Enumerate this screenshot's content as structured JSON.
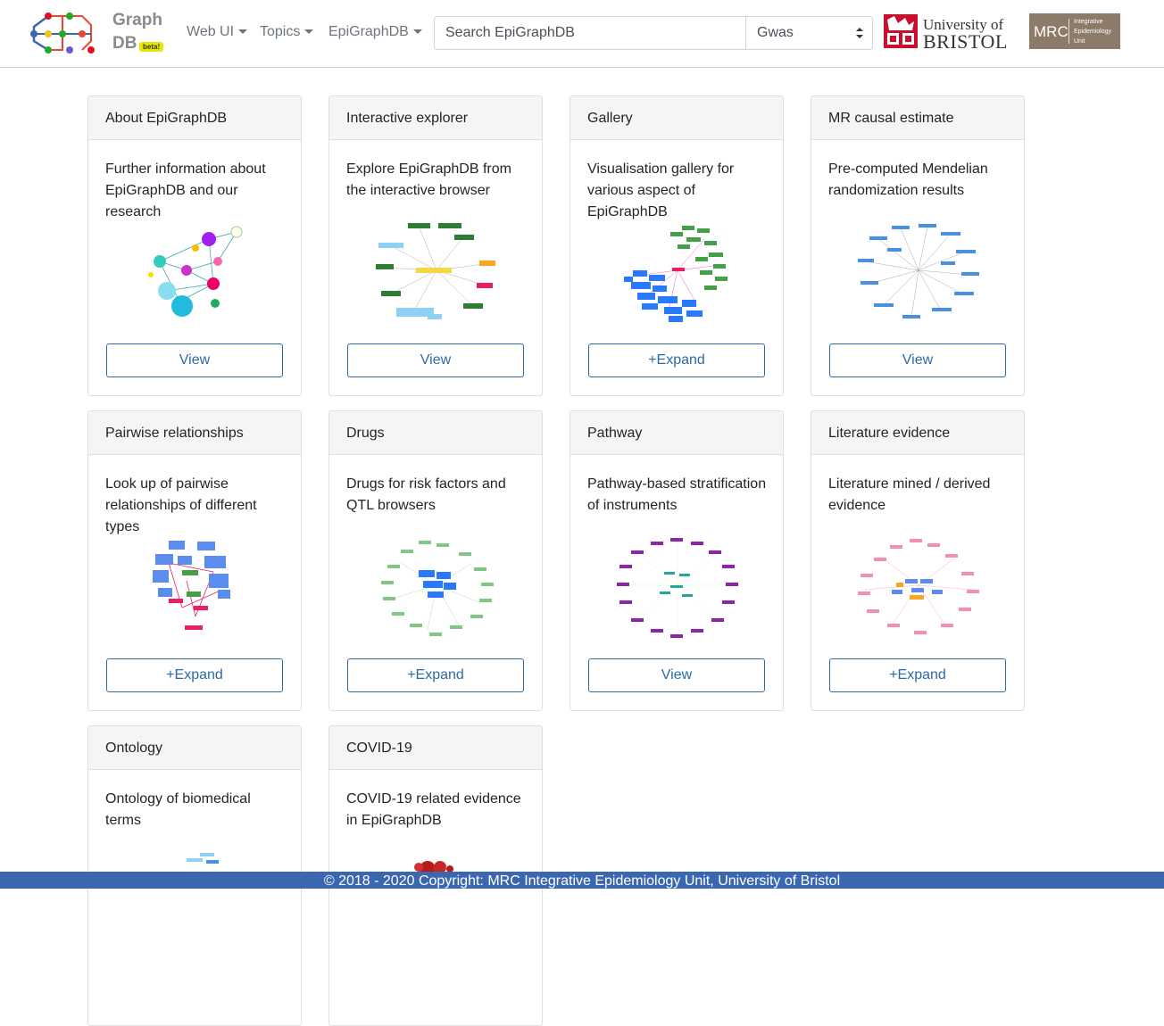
{
  "logo": {
    "line1": "Graph",
    "line2": "DB",
    "badge": "beta!"
  },
  "nav": {
    "links": [
      {
        "label": "Web UI"
      },
      {
        "label": "Topics"
      },
      {
        "label": "EpiGraphDB"
      }
    ],
    "search_placeholder": "Search EpiGraphDB",
    "select_value": "Gwas"
  },
  "partners": {
    "bristol": {
      "line1": "University of",
      "line2": "BRISTOL"
    },
    "mrc": {
      "big": "MRC",
      "small1": "Integrative",
      "small2": "Epidemiology",
      "small3": "Unit"
    }
  },
  "cards": [
    {
      "title": "About EpiGraphDB",
      "text": "Further information about EpiGraphDB and our research",
      "button": "View",
      "thumb": "network-colorful-icon"
    },
    {
      "title": "Interactive explorer",
      "text": "Explore EpiGraphDB from the interactive browser",
      "button": "View",
      "thumb": "network-ring-icon"
    },
    {
      "title": "Gallery",
      "text": "Visualisation gallery for various aspect of EpiGraphDB",
      "button": "+Expand",
      "thumb": "network-cluster-icon"
    },
    {
      "title": "MR causal estimate",
      "text": "Pre-computed Mendelian randomization results",
      "button": "View",
      "thumb": "network-star-icon"
    },
    {
      "title": "Pairwise relationships",
      "text": "Look up of pairwise relationships of different types",
      "button": "+Expand",
      "thumb": "network-pairwise-icon"
    },
    {
      "title": "Drugs",
      "text": "Drugs for risk factors and QTL browsers",
      "button": "+Expand",
      "thumb": "network-drugs-icon"
    },
    {
      "title": "Pathway",
      "text": "Pathway-based stratification of instruments",
      "button": "View",
      "thumb": "network-pathway-icon"
    },
    {
      "title": "Literature evidence",
      "text": "Literature mined / derived evidence",
      "button": "+Expand",
      "thumb": "network-literature-icon"
    },
    {
      "title": "Ontology",
      "text": "Ontology of biomedical terms",
      "button": "",
      "thumb": "network-ontology-icon"
    },
    {
      "title": "COVID-19",
      "text": "COVID-19 related evidence in EpiGraphDB",
      "button": "",
      "thumb": "virus-icon"
    }
  ],
  "footer": {
    "text": "© 2018 - 2020 Copyright: MRC Integrative Epidemiology Unit, University of Bristol"
  },
  "colors": {
    "accent": "#2c6aa8",
    "footer_bg": "#3a67b0",
    "card_header_bg": "#f5f5f5"
  }
}
